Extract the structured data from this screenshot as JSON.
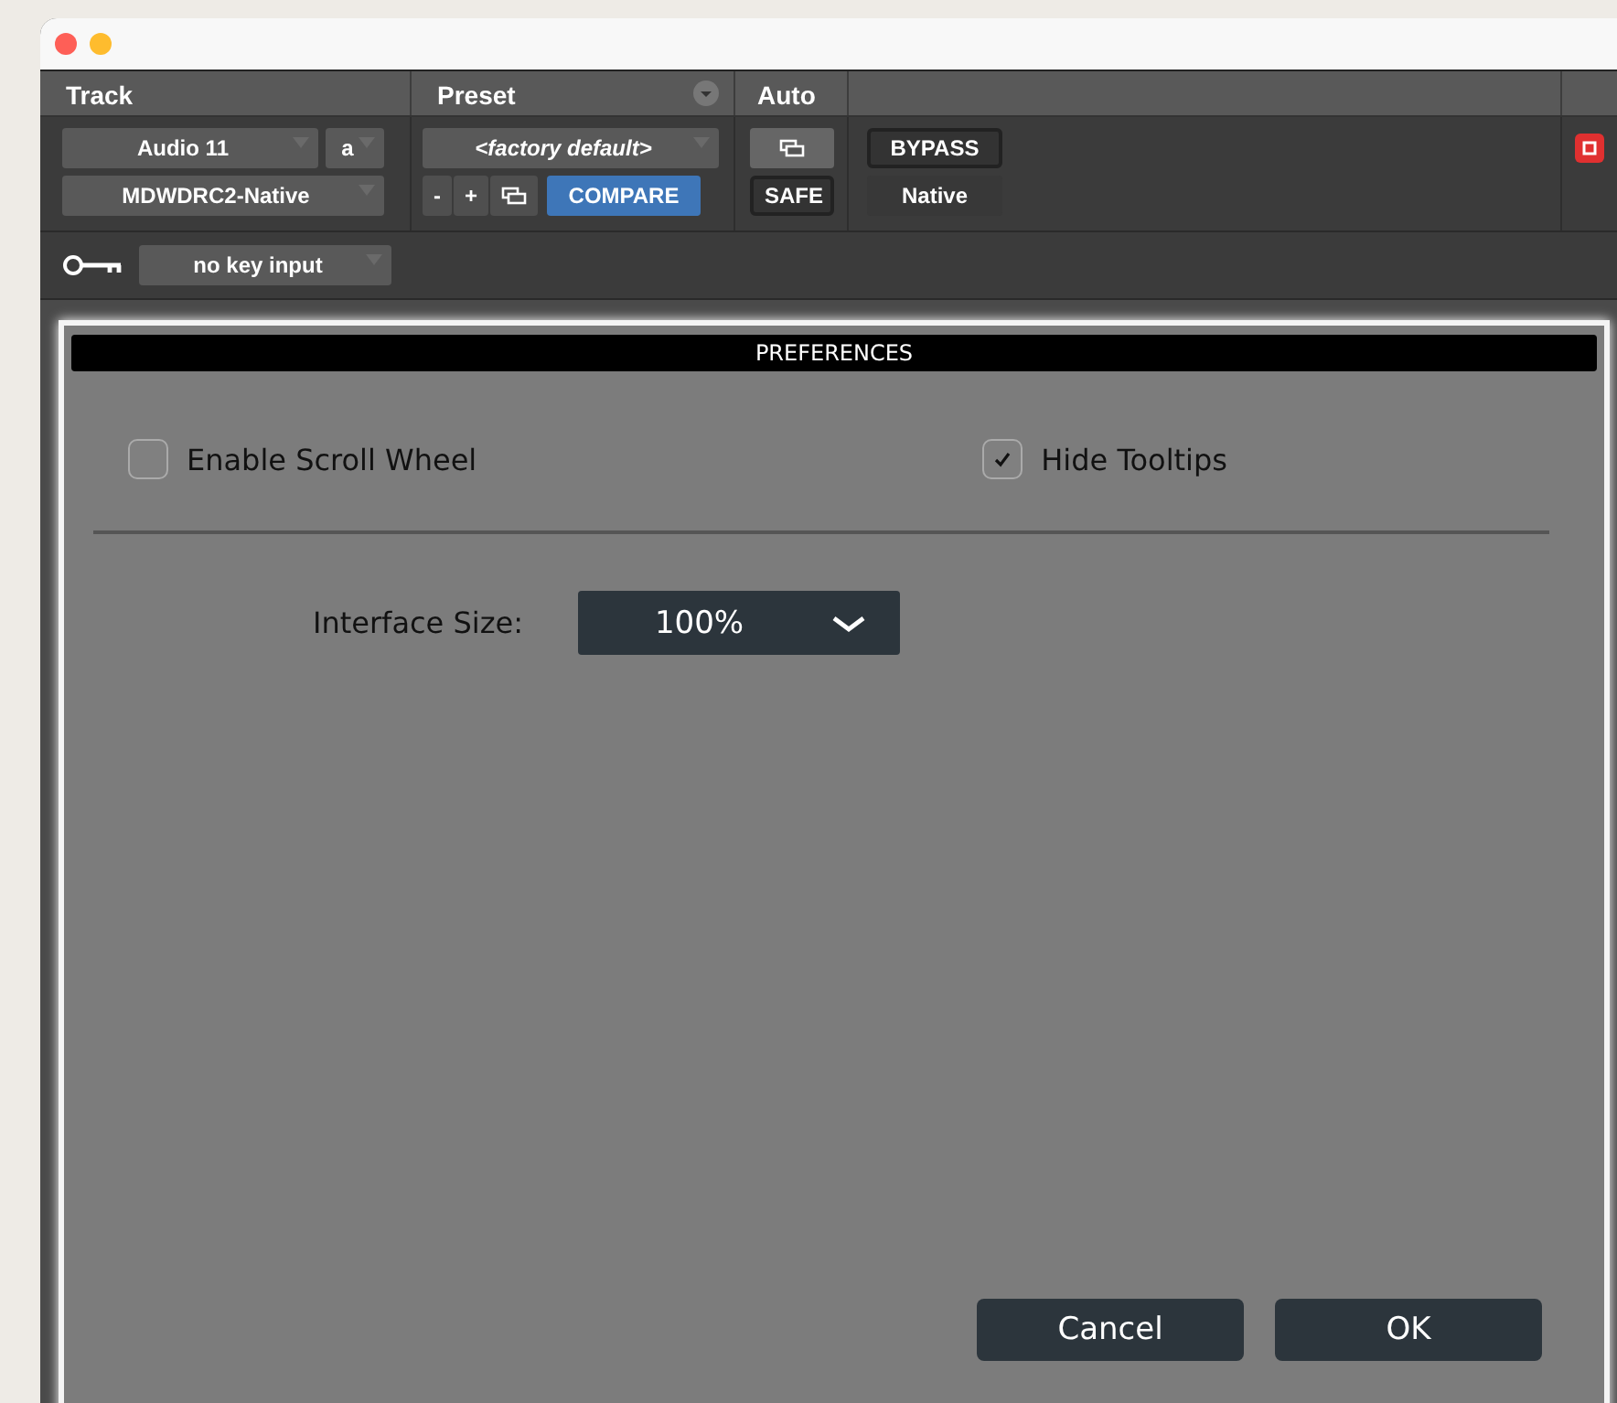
{
  "plugin": {
    "columns": [
      {
        "label": "Track"
      },
      {
        "label": "Preset"
      },
      {
        "label": "Auto"
      }
    ],
    "track": {
      "name": "Audio 11",
      "channel": "a",
      "plugin": "MDWDRC2-Native"
    },
    "preset": {
      "name": "<factory default>",
      "minus": "-",
      "plus": "+",
      "compare": {
        "label": "COMPARE",
        "on": true
      }
    },
    "auto": {
      "safe": "SAFE"
    },
    "bypass": "BYPASS",
    "native": "Native",
    "key_input": "no key input"
  },
  "dialog": {
    "title": "PREFERENCES",
    "checkboxes": [
      {
        "label": "Enable Scroll Wheel",
        "checked": false
      },
      {
        "label": "Hide Tooltips",
        "checked": true
      }
    ],
    "interface_size": {
      "label": "Interface Size:",
      "value": "100%"
    },
    "buttons": [
      {
        "label": "Cancel"
      },
      {
        "label": "OK"
      }
    ]
  }
}
